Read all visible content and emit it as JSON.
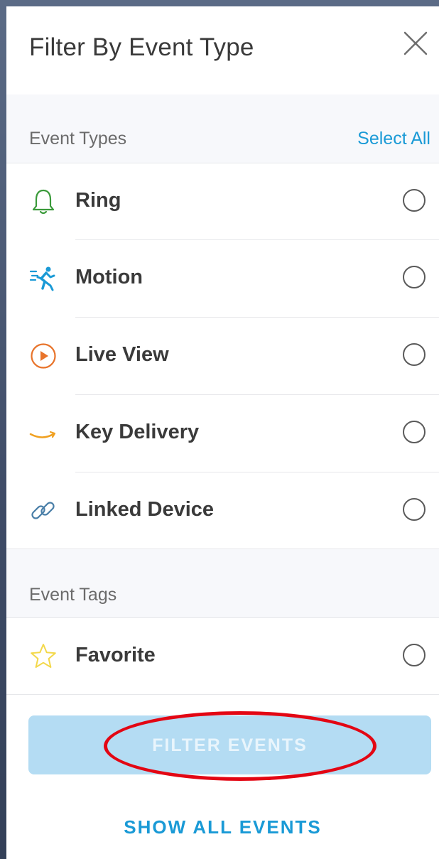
{
  "header": {
    "title": "Filter By Event Type"
  },
  "event_types": {
    "label": "Event Types",
    "select_all": "Select All",
    "items": [
      {
        "label": "Ring",
        "icon": "bell-icon",
        "color": "#3a9a3a",
        "selected": false
      },
      {
        "label": "Motion",
        "icon": "motion-runner-icon",
        "color": "#1a9ad6",
        "selected": false
      },
      {
        "label": "Live View",
        "icon": "play-circle-icon",
        "color": "#e8732a",
        "selected": false
      },
      {
        "label": "Key Delivery",
        "icon": "amazon-smile-icon",
        "color": "#f0a020",
        "selected": false
      },
      {
        "label": "Linked Device",
        "icon": "link-icon",
        "color": "#4a7fa8",
        "selected": false
      }
    ]
  },
  "event_tags": {
    "label": "Event Tags",
    "items": [
      {
        "label": "Favorite",
        "icon": "star-icon",
        "color": "#f3d84a",
        "selected": false
      }
    ]
  },
  "actions": {
    "filter_label": "FILTER EVENTS",
    "show_all_label": "SHOW ALL EVENTS"
  },
  "colors": {
    "accent": "#1a9ad6",
    "filter_button_disabled": "#b4dcf3",
    "annotation": "#e30613"
  }
}
